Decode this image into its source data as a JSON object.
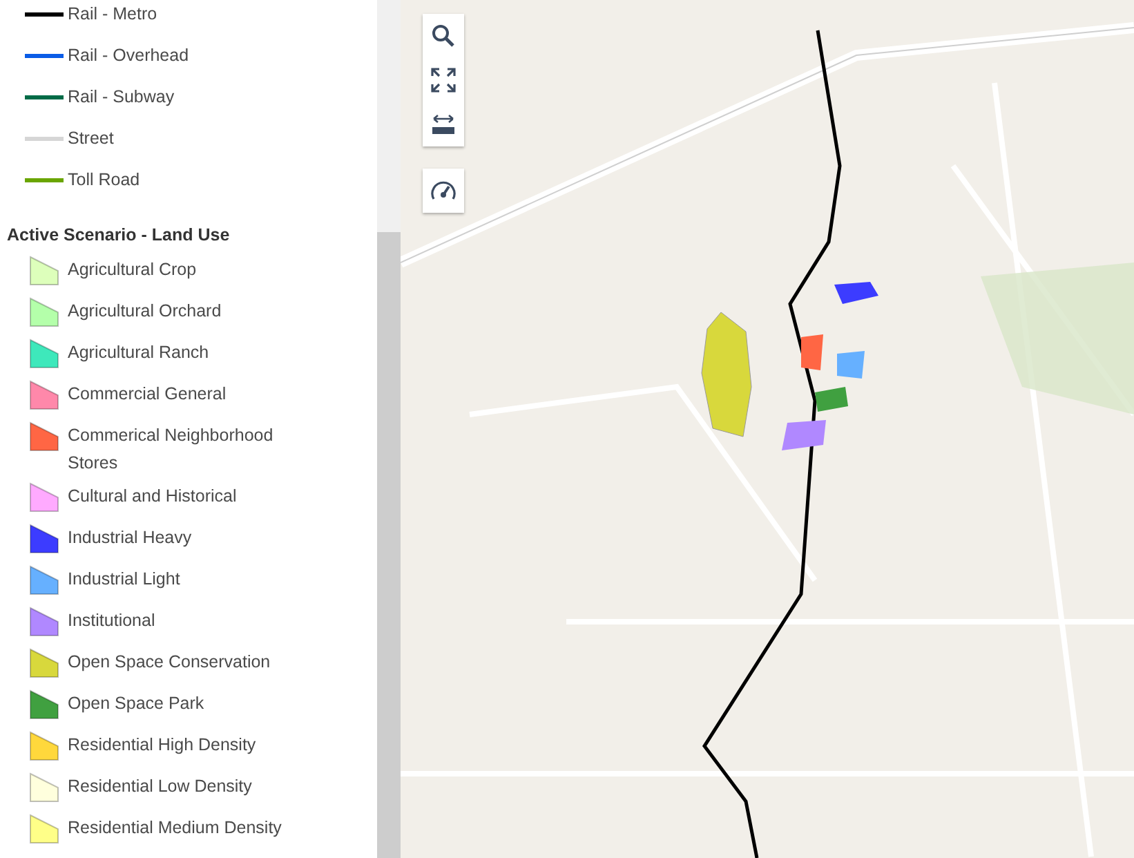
{
  "legend": {
    "lines": [
      {
        "label": "Rail - Metro",
        "color": "#000000"
      },
      {
        "label": "Rail - Overhead",
        "color": "#0a5ce6"
      },
      {
        "label": "Rail - Subway",
        "color": "#006b47"
      },
      {
        "label": "Street",
        "color": "#d6d6d6"
      },
      {
        "label": "Toll Road",
        "color": "#6aa500"
      }
    ],
    "section_title": "Active Scenario - Land Use",
    "land_use": [
      {
        "label": "Agricultural Crop",
        "color": "#ddffbb"
      },
      {
        "label": "Agricultural Orchard",
        "color": "#b4ffaa"
      },
      {
        "label": "Agricultural Ranch",
        "color": "#3ee8bb"
      },
      {
        "label": "Commercial General",
        "color": "#ff88aa"
      },
      {
        "label": "Commerical Neighborhood Stores",
        "color": "#ff6644"
      },
      {
        "label": "Cultural and Historical",
        "color": "#ffaaff"
      },
      {
        "label": "Industrial Heavy",
        "color": "#3c3cff"
      },
      {
        "label": "Industrial Light",
        "color": "#66b0ff"
      },
      {
        "label": "Institutional",
        "color": "#b088ff"
      },
      {
        "label": "Open Space Conservation",
        "color": "#d8d83c"
      },
      {
        "label": "Open Space Park",
        "color": "#40a040"
      },
      {
        "label": "Residential High Density",
        "color": "#ffd83c"
      },
      {
        "label": "Residential Low Density",
        "color": "#ffffdd"
      },
      {
        "label": "Residential Medium Density",
        "color": "#ffff88"
      }
    ]
  }
}
